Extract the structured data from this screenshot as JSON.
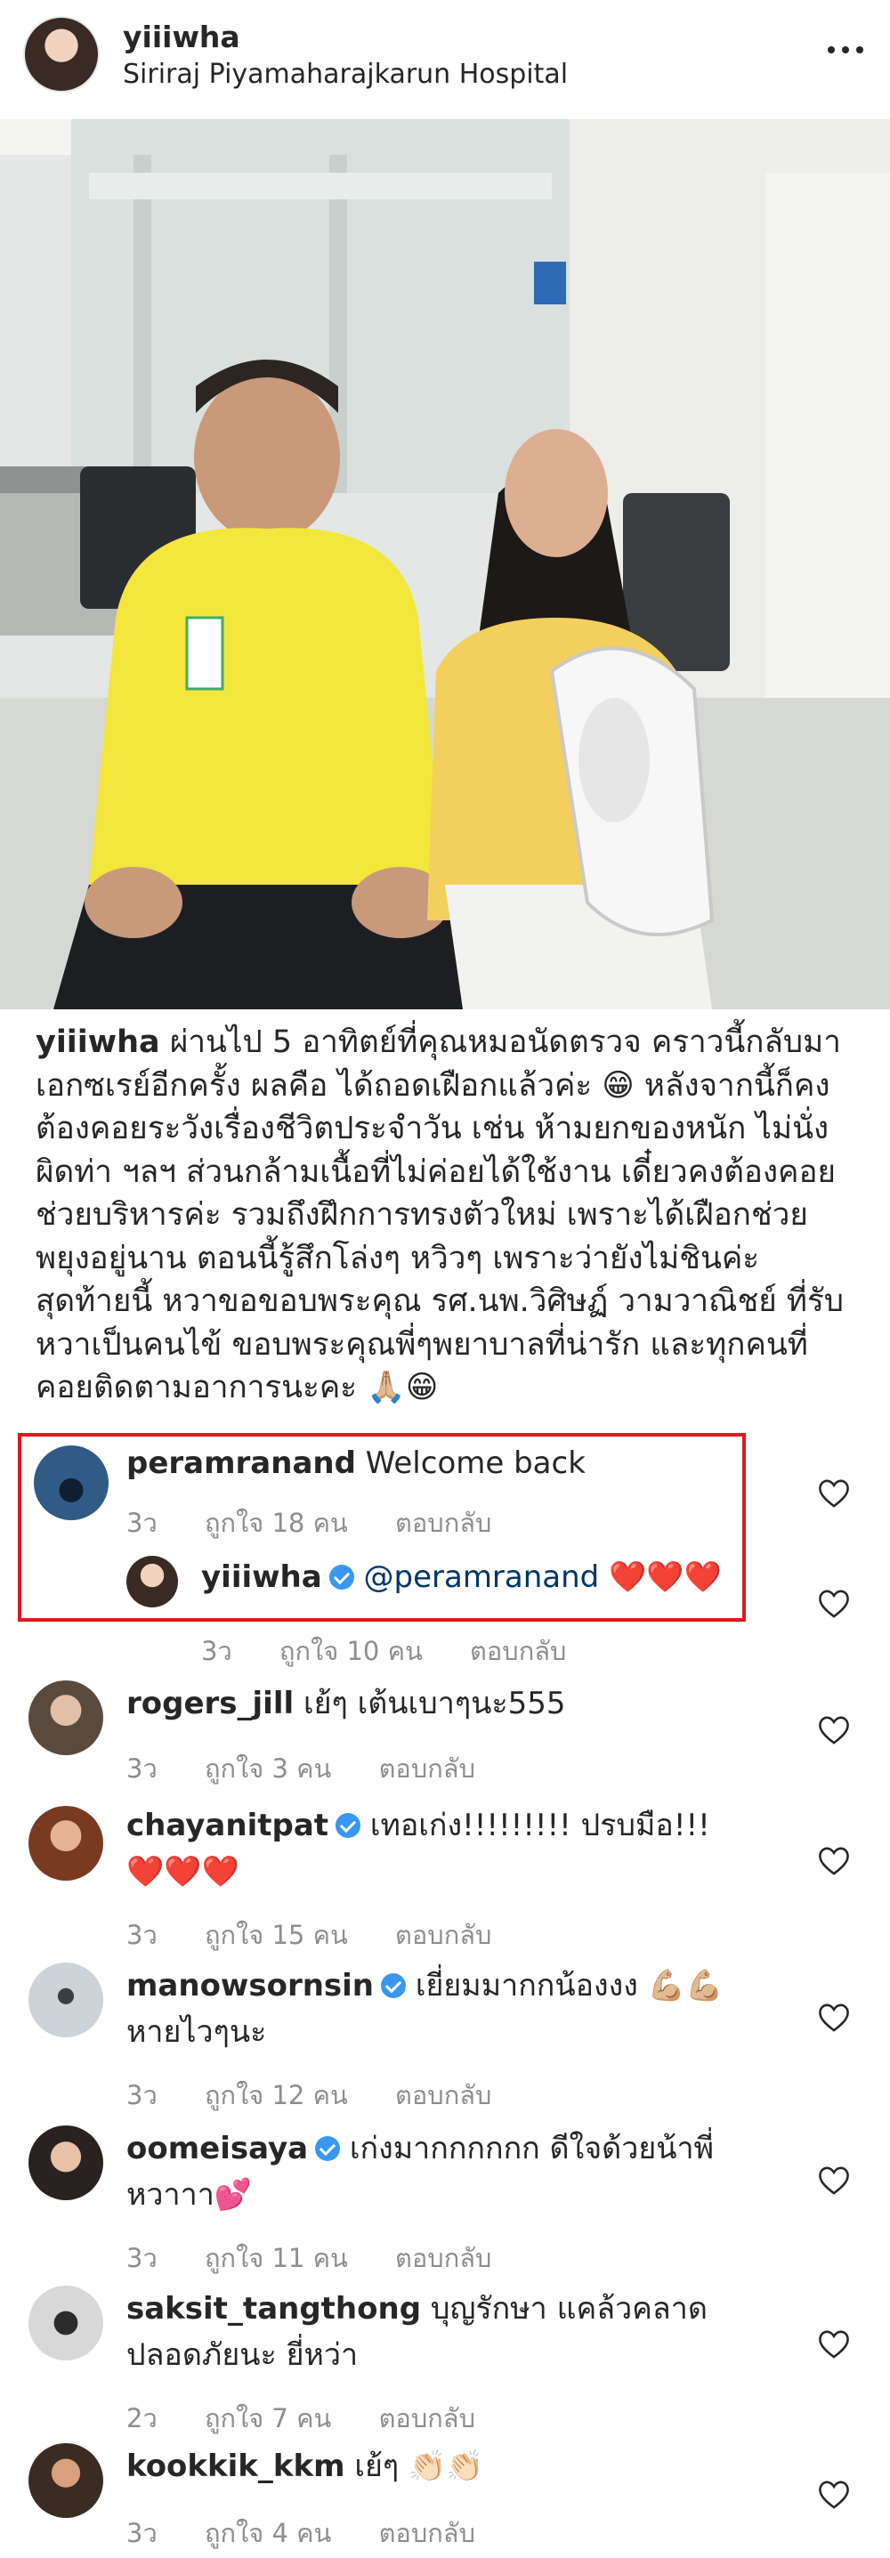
{
  "post": {
    "username": "yiiiwha",
    "location": "Siriraj Piyamaharajkarun Hospital",
    "more_icon": "more-dots-icon"
  },
  "caption": {
    "username": "yiiiwha",
    "text": "ผ่านไป 5 อาทิตย์ที่คุณหมอนัดตรวจ คราวนี้กลับมาเอกซเรย์อีกครั้ง ผลคือ ได้ถอดเฝือกแล้วค่ะ 😁 หลังจากนี้ก็คงต้องคอยระวังเรื่องชีวิตประจำวัน เช่น ห้ามยกของหนัก ไม่นั่งผิดท่า ฯลฯ ส่วนกล้ามเนื้อที่ไม่ค่อยได้ใช้งาน เดี๋ยวคงต้องคอยช่วยบริหารค่ะ รวมถึงฝึกการทรงตัวใหม่ เพราะได้เฝือกช่วยพยุงอยู่นาน ตอนนี้รู้สึกโล่งๆ หวิวๆ เพราะว่ายังไม่ชินค่ะ สุดท้ายนี้ หวาขอขอบพระคุณ รศ.นพ.วิศิษฏ์ วามวาณิชย์ ที่รับหวาเป็นคนไข้ ขอบพระคุณพี่ๆพยาบาลที่น่ารัก และทุกคนที่คอยติดตามอาการนะคะ 🙏🏼😁"
  },
  "comments": [
    {
      "username": "peramranand",
      "text": "Welcome back",
      "time": "3ว",
      "likes": "ถูกใจ 18 คน",
      "reply": "ตอบกลับ",
      "verified": false
    },
    {
      "username": "yiiiwha",
      "mention": "@peramranand",
      "text": "❤️❤️❤️",
      "time": "3ว",
      "likes": "ถูกใจ 10 คน",
      "reply": "ตอบกลับ",
      "verified": true
    },
    {
      "username": "rogers_jill",
      "text": "เย้ๆ เต้นเบาๆนะ555",
      "time": "3ว",
      "likes": "ถูกใจ 3 คน",
      "reply": "ตอบกลับ",
      "verified": false
    },
    {
      "username": "chayanitpat",
      "text": "เทอเก่ง!!!!!!!!! ปรบมือ!!!",
      "text2": "❤️❤️❤️",
      "time": "3ว",
      "likes": "ถูกใจ 15 คน",
      "reply": "ตอบกลับ",
      "verified": true
    },
    {
      "username": "manowsornsin",
      "text": "เยี่ยมมากกน้องงง 💪🏼💪🏼",
      "text2": "หายไวๆนะ",
      "time": "3ว",
      "likes": "ถูกใจ 12 คน",
      "reply": "ตอบกลับ",
      "verified": true
    },
    {
      "username": "oomeisaya",
      "text": "เก่งมากกกกกก ดีใจด้วยน้าพี่",
      "text2": "หวาาา💕",
      "time": "3ว",
      "likes": "ถูกใจ 11 คน",
      "reply": "ตอบกลับ",
      "verified": true
    },
    {
      "username": "saksit_tangthong",
      "text": "บุญรักษา แคล้วคลาด",
      "text2": "ปลอดภัยนะ ยี่หว่า",
      "time": "2ว",
      "likes": "ถูกใจ 7 คน",
      "reply": "ตอบกลับ",
      "verified": false
    },
    {
      "username": "kookkik_kkm",
      "text": "เย้ๆ 👏🏻👏🏻",
      "time": "3ว",
      "likes": "ถูกใจ 4 คน",
      "reply": "ตอบกลับ",
      "verified": false
    }
  ],
  "icons": {
    "heart": "heart-outline-icon",
    "verified": "verified-badge-icon"
  },
  "colors": {
    "highlight_box": "#e3161f",
    "verified": "#3897f0",
    "meta_text": "#8e8e8e"
  }
}
